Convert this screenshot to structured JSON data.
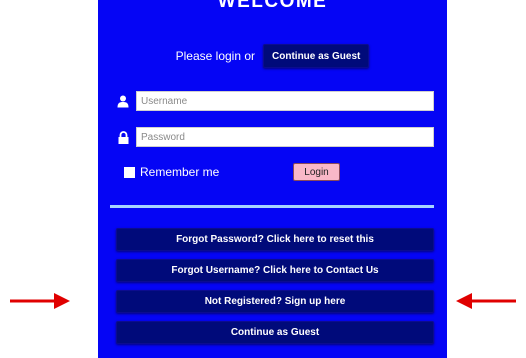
{
  "panel": {
    "title": "WELCOME",
    "login_prompt": "Please login or",
    "guest_button_label": "Continue as Guest",
    "username_placeholder": "Username",
    "password_placeholder": "Password",
    "remember_label": "Remember me",
    "login_button_label": "Login",
    "actions": [
      {
        "label": "Forgot Password? Click here to reset this"
      },
      {
        "label": "Forgot Username? Click here to Contact Us"
      },
      {
        "label": "Not Registered?   Sign up here"
      },
      {
        "label": "Continue as Guest"
      }
    ]
  },
  "colors": {
    "panel_bg": "#0505f5",
    "button_dark": "#000a7a",
    "login_pink": "#f9b8c8",
    "divider": "#a6d5ff",
    "arrow_red": "#e00000"
  },
  "icons": {
    "username": "user-icon",
    "password": "lock-icon",
    "pointer_left": "red-arrow-right-icon",
    "pointer_right": "red-arrow-left-icon"
  }
}
